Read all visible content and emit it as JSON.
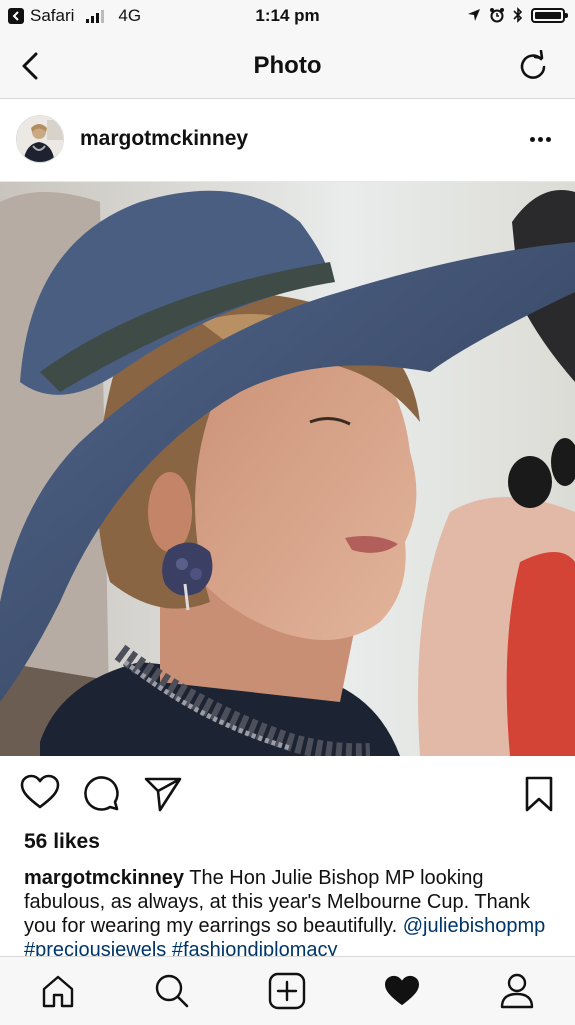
{
  "status_bar": {
    "back_app": "Safari",
    "carrier": "4G",
    "time": "1:14 pm"
  },
  "nav": {
    "title": "Photo",
    "back_icon": "chevron-left-icon",
    "refresh_icon": "refresh-icon"
  },
  "post": {
    "username": "margotmckinney",
    "likes": "56 likes",
    "caption_user": "margotmckinney",
    "caption_text": " The Hon Julie Bishop MP looking fabulous, as always, at this year's Melbourne Cup. Thank you for wearing my earrings so beautifully. ",
    "caption_tags": "@juliebishopmp #preciousjewels #fashiondiplomacy"
  },
  "tabs": [
    "home-icon",
    "search-icon",
    "add-post-icon",
    "activity-heart-icon",
    "profile-icon"
  ],
  "colors": {
    "bar_bg": "#f7f7f7",
    "hashtag": "#003569",
    "hat": "#3e5270"
  }
}
